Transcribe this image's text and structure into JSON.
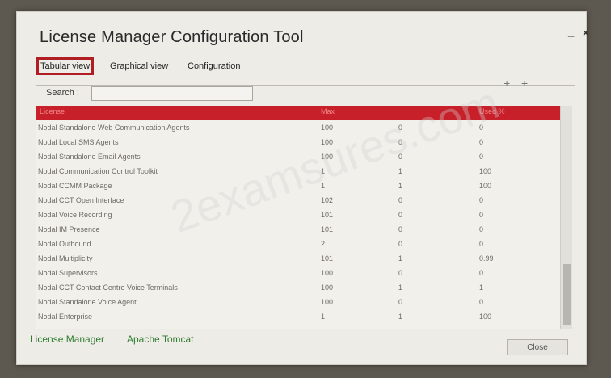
{
  "window": {
    "title": "License Manager Configuration Tool",
    "minimize_glyph": "_",
    "close_glyph": "×"
  },
  "tabs": [
    {
      "label": "Tabular view",
      "active": true
    },
    {
      "label": "Graphical view",
      "active": false
    },
    {
      "label": "Configuration",
      "active": false
    }
  ],
  "search": {
    "label": "Search :",
    "value": ""
  },
  "table": {
    "columns": [
      "License",
      "Max",
      "",
      "Used %"
    ],
    "rows": [
      {
        "name": "Nodal Standalone Web Communication Agents",
        "max": "100",
        "inuse": "0",
        "util": "0"
      },
      {
        "name": "Nodal Local SMS Agents",
        "max": "100",
        "inuse": "0",
        "util": "0"
      },
      {
        "name": "Nodal Standalone Email Agents",
        "max": "100",
        "inuse": "0",
        "util": "0"
      },
      {
        "name": "Nodal Communication Control Toolkit",
        "max": "1",
        "inuse": "1",
        "util": "100"
      },
      {
        "name": "Nodal CCMM Package",
        "max": "1",
        "inuse": "1",
        "util": "100"
      },
      {
        "name": "Nodal CCT Open Interface",
        "max": "102",
        "inuse": "0",
        "util": "0"
      },
      {
        "name": "Nodal Voice Recording",
        "max": "101",
        "inuse": "0",
        "util": "0"
      },
      {
        "name": "Nodal IM Presence",
        "max": "101",
        "inuse": "0",
        "util": "0"
      },
      {
        "name": "Nodal Outbound",
        "max": "2",
        "inuse": "0",
        "util": "0"
      },
      {
        "name": "Nodal Multiplicity",
        "max": "101",
        "inuse": "1",
        "util": "0.99"
      },
      {
        "name": "Nodal Supervisors",
        "max": "100",
        "inuse": "0",
        "util": "0"
      },
      {
        "name": "Nodal CCT Contact Centre Voice Terminals",
        "max": "100",
        "inuse": "1",
        "util": "1"
      },
      {
        "name": "Nodal Standalone Voice Agent",
        "max": "100",
        "inuse": "0",
        "util": "0"
      },
      {
        "name": "Nodal Enterprise",
        "max": "1",
        "inuse": "1",
        "util": "100"
      }
    ]
  },
  "footer": {
    "links": [
      "License Manager",
      "Apache Tomcat"
    ],
    "close_label": "Close"
  },
  "watermark": "2examsures.com",
  "colors": {
    "accent": "#c8202a",
    "link": "#2e7d32"
  }
}
